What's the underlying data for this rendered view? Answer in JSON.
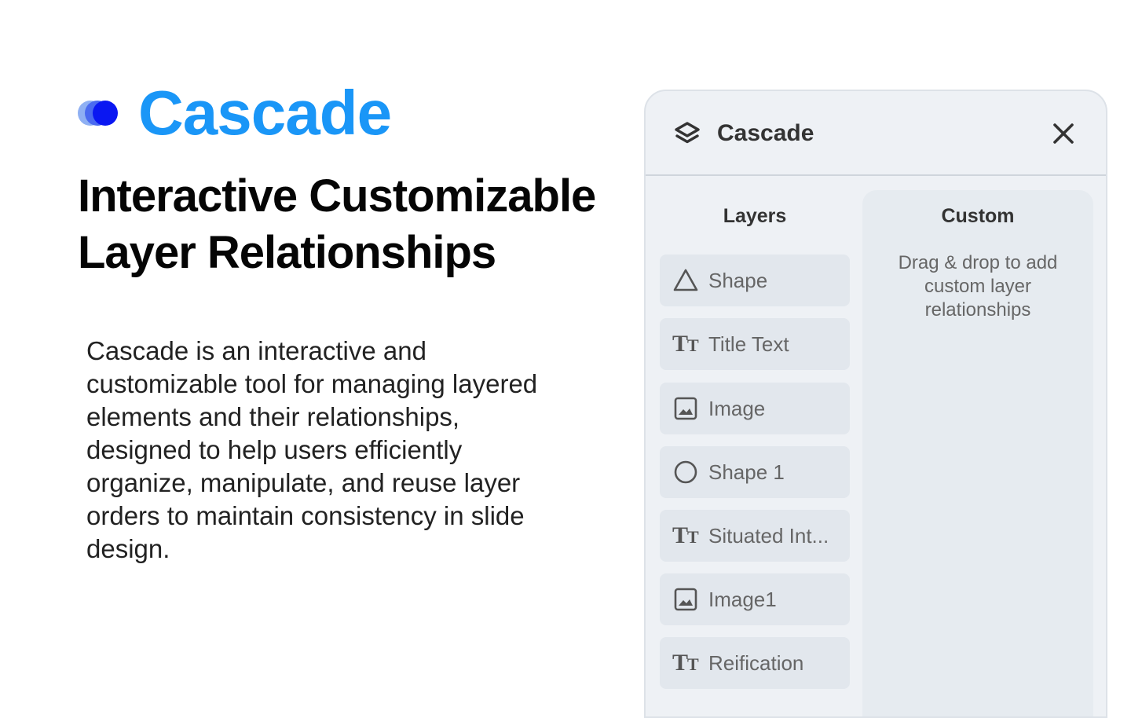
{
  "hero": {
    "brand": "Cascade",
    "headline_line1": "Interactive Customizable",
    "headline_line2": "Layer Relationships",
    "description": "Cascade is an interactive and customizable tool for managing layered elements and their relationships, designed to help users efficiently organize, manipulate, and reuse layer orders to maintain consistency in slide design.",
    "brand_color": "#1a96f7",
    "logo_colors": [
      "#8fb0f3",
      "#4a6af0",
      "#0a17f2"
    ]
  },
  "panel": {
    "title": "Cascade",
    "title_icon": "layers-icon",
    "close_icon": "close-icon",
    "layers": {
      "heading": "Layers",
      "items": [
        {
          "label": "Shape",
          "icon": "triangle-icon"
        },
        {
          "label": "Title Text",
          "icon": "text-icon"
        },
        {
          "label": "Image",
          "icon": "image-icon"
        },
        {
          "label": "Shape 1",
          "icon": "circle-icon"
        },
        {
          "label": "Situated Int...",
          "icon": "text-icon"
        },
        {
          "label": "Image1",
          "icon": "image-icon"
        },
        {
          "label": "Reification",
          "icon": "text-icon"
        }
      ]
    },
    "custom": {
      "heading": "Custom",
      "hint": "Drag & drop to add custom layer relationships"
    }
  }
}
